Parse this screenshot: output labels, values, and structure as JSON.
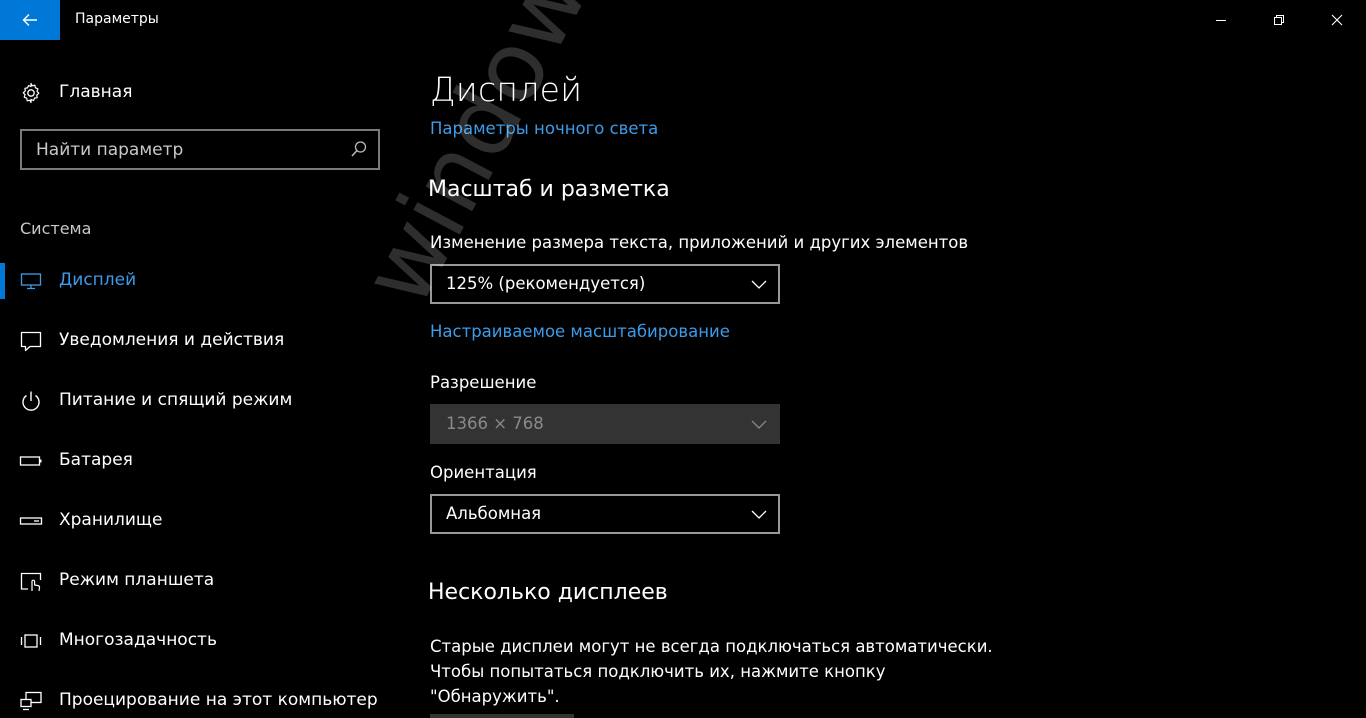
{
  "window": {
    "title": "Параметры",
    "accent": "#0078d7"
  },
  "sidebar": {
    "home_label": "Главная",
    "search_placeholder": "Найти параметр",
    "section": "Система",
    "items": [
      {
        "label": "Дисплей",
        "icon": "display-icon",
        "active": true
      },
      {
        "label": "Уведомления и действия",
        "icon": "notifications-icon"
      },
      {
        "label": "Питание и спящий режим",
        "icon": "power-icon"
      },
      {
        "label": "Батарея",
        "icon": "battery-icon"
      },
      {
        "label": "Хранилище",
        "icon": "storage-icon"
      },
      {
        "label": "Режим планшета",
        "icon": "tablet-mode-icon"
      },
      {
        "label": "Многозадачность",
        "icon": "multitasking-icon"
      },
      {
        "label": "Проецирование на этот компьютер",
        "icon": "projecting-icon"
      }
    ]
  },
  "main": {
    "title": "Дисплей",
    "night_light_link": "Параметры ночного света",
    "scale_heading": "Масштаб и разметка",
    "scale_label": "Изменение размера текста, приложений и других элементов",
    "scale_value": "125% (рекомендуется)",
    "custom_scaling_link": "Настраиваемое масштабирование",
    "resolution_label": "Разрешение",
    "resolution_value": "1366 × 768",
    "orientation_label": "Ориентация",
    "orientation_value": "Альбомная",
    "multi_heading": "Несколько дисплеев",
    "multi_text_1": "Старые дисплеи могут не всегда подключаться автоматически.",
    "multi_text_2": "Чтобы попытаться подключить их, нажмите кнопку",
    "multi_text_3": "\"Обнаружить\"."
  },
  "watermark": "windowstips.ru"
}
